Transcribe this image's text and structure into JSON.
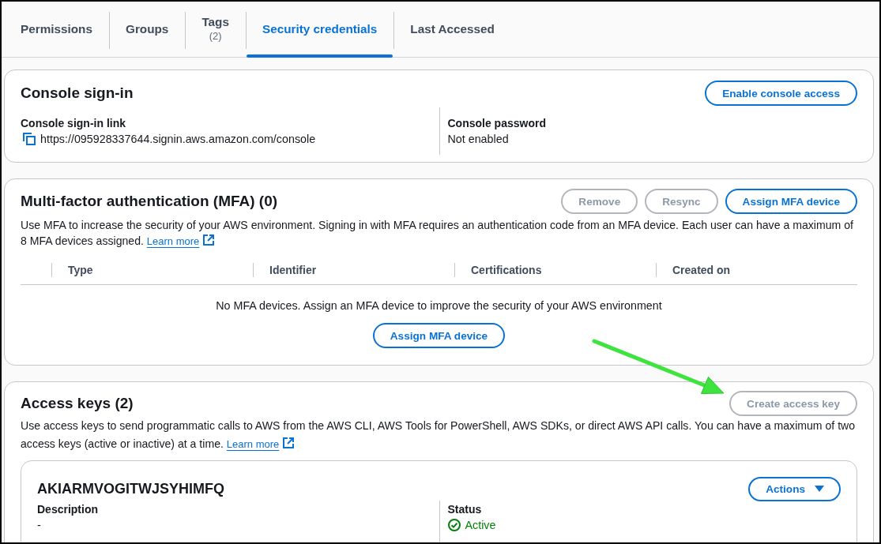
{
  "tabs": [
    {
      "label": "Permissions",
      "selected": false
    },
    {
      "label": "Groups",
      "selected": false
    },
    {
      "label": "Tags",
      "count": "(2)",
      "selected": false
    },
    {
      "label": "Security credentials",
      "selected": true
    },
    {
      "label": "Last Accessed",
      "selected": false
    }
  ],
  "console_sign_in": {
    "title": "Console sign-in",
    "button": {
      "label": "Enable console access",
      "disabled": false
    },
    "fields": [
      {
        "kind": "copy",
        "label": "Console sign-in link",
        "value": "https://095928337644.signin.aws.amazon.com/console"
      },
      {
        "kind": "text",
        "label": "Console password",
        "value": "Not enabled"
      }
    ]
  },
  "mfa": {
    "title": "Multi-factor authentication (MFA) (0)",
    "buttons": [
      {
        "label": "Remove",
        "disabled": true
      },
      {
        "label": "Resync",
        "disabled": true
      },
      {
        "label": "Assign MFA device",
        "disabled": false
      }
    ],
    "description": "Use MFA to increase the security of your AWS environment. Signing in with MFA requires an authentication code from an MFA device. Each user can have a maximum of 8 MFA devices assigned.",
    "link": "Learn more",
    "table": {
      "columns": [
        "Type",
        "Identifier",
        "Certifications",
        "Created on"
      ],
      "empty_message": "No MFA devices. Assign an MFA device to improve the security of your AWS environment",
      "empty_button": {
        "label": "Assign MFA device",
        "disabled": false
      }
    }
  },
  "annotation": {
    "kind": "arrow"
  },
  "access_keys": {
    "title": "Access keys (2)",
    "button": {
      "label": "Create access key",
      "disabled": true
    },
    "description": "Use access keys to send programmatic calls to AWS from the AWS CLI, AWS Tools for PowerShell, AWS SDKs, or direct AWS API calls. You can have a maximum of two access keys (active or inactive) at a time.",
    "link": "Learn more",
    "keys": [
      {
        "id": "AKIARMVOGITWJSYHIMFQ",
        "button": {
          "label": "Actions",
          "disabled": false
        },
        "fields": [
          {
            "kind": "text",
            "label": "Description",
            "value": "-"
          },
          {
            "kind": "status",
            "label": "Status",
            "value": "Active"
          }
        ]
      }
    ]
  }
}
